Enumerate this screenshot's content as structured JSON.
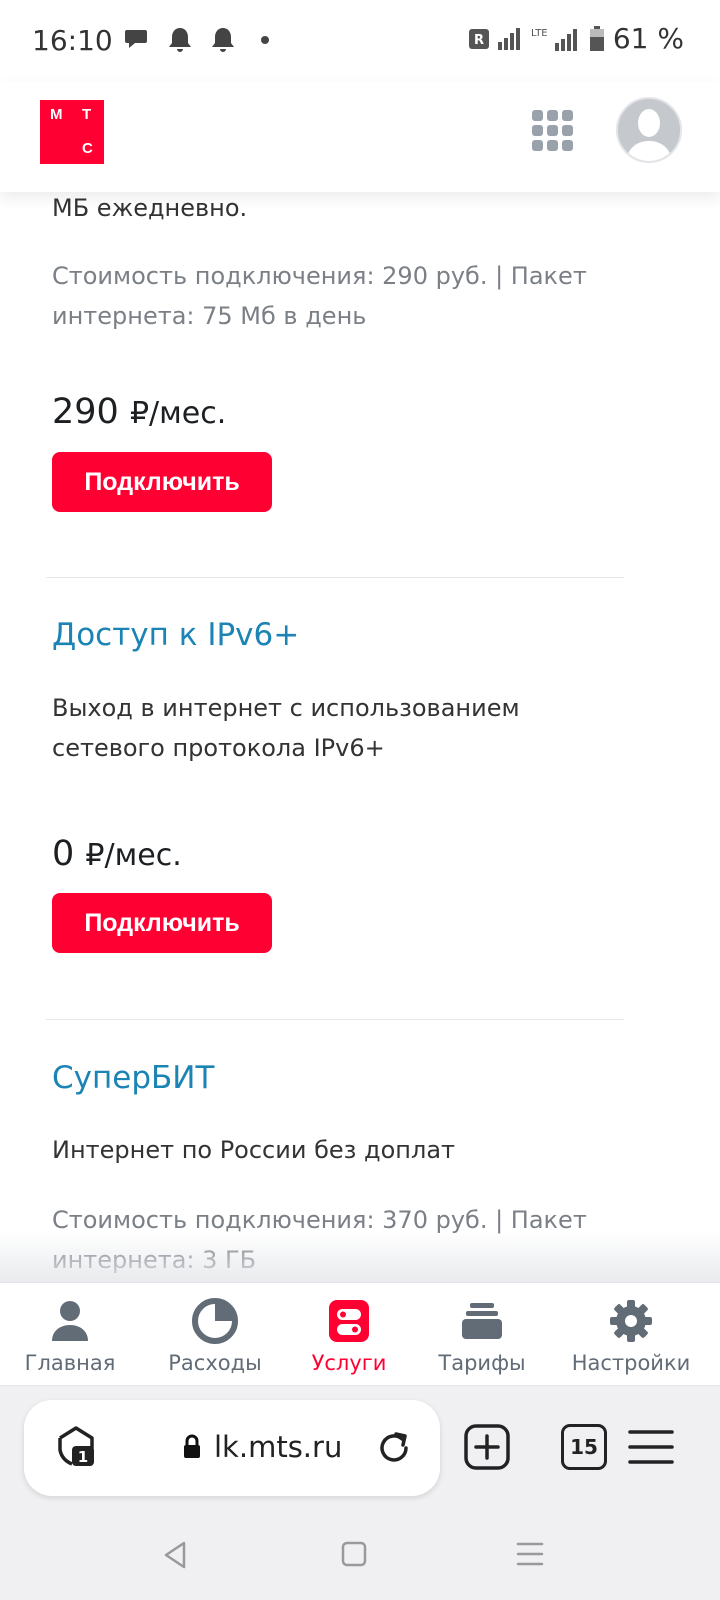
{
  "status_bar": {
    "time": "16:10",
    "battery_percent": "61 %",
    "network": "LTE",
    "roaming_badge": "R"
  },
  "header": {
    "logo_letters": [
      "М",
      "Т",
      "С"
    ],
    "logo_color": "#ff0032"
  },
  "services": [
    {
      "title": "",
      "description": "МБ ежедневно.",
      "details": "Стоимость подключения: 290 руб. | Пакет интернета: 75 Мб в день",
      "price": "290",
      "price_unit": "₽/мес.",
      "button_label": "Подключить"
    },
    {
      "title": "Доступ к IPv6+",
      "description": "Выход в интернет с использованием сетевого протокола IPv6+",
      "price": "0",
      "price_unit": "₽/мес.",
      "button_label": "Подключить"
    },
    {
      "title": "СуперБИТ",
      "description": "Интернет по России без доплат",
      "details": "Стоимость подключения: 370 руб. | Пакет интернета: 3 ГБ"
    }
  ],
  "bottom_nav": {
    "items": [
      {
        "label": "Главная",
        "icon": "person-icon"
      },
      {
        "label": "Расходы",
        "icon": "pie-chart-icon"
      },
      {
        "label": "Услуги",
        "icon": "services-icon",
        "active": true
      },
      {
        "label": "Тарифы",
        "icon": "stack-icon"
      },
      {
        "label": "Настройки",
        "icon": "gear-icon"
      }
    ],
    "active_color": "#ff0032"
  },
  "browser": {
    "url": "lk.mts.ru",
    "shield_count": "1",
    "tab_count": "15"
  }
}
